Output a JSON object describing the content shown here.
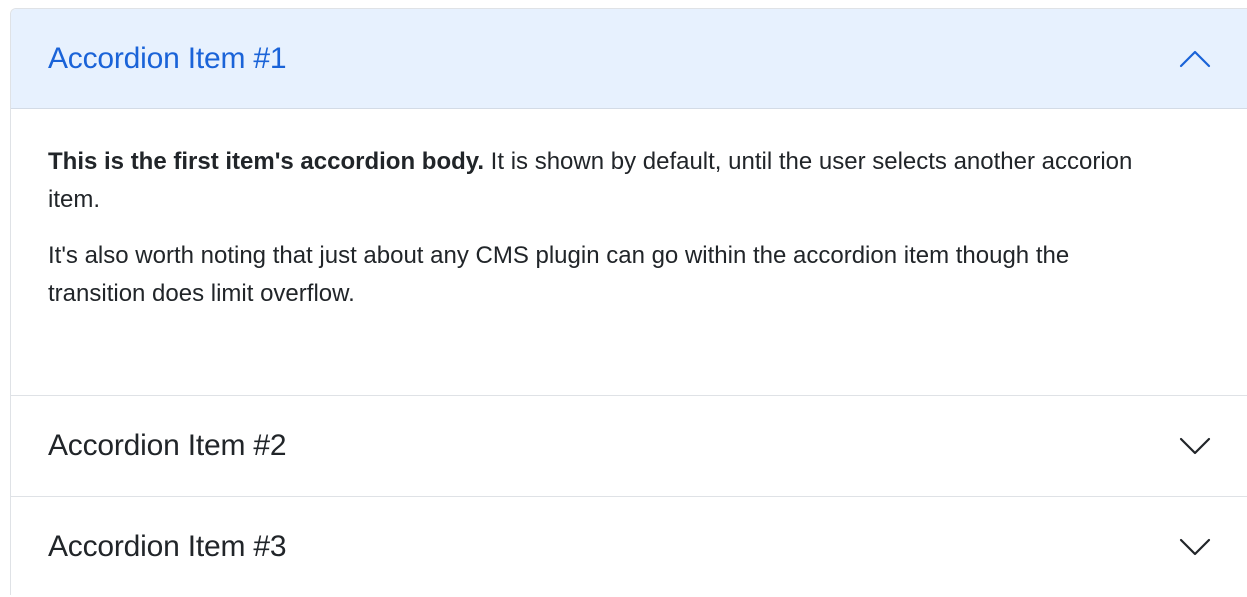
{
  "accordion": {
    "items": [
      {
        "title": "Accordion Item #1",
        "expanded": true,
        "toggle_icon": "chevron-up-icon",
        "body": {
          "p1_bold": "This is the first item's accordion body.",
          "p1_rest": " It is shown by default, until the user selects another accorion item.",
          "p2": "It's also worth noting that just about any CMS plugin can go within the accordion item though the transition does limit overflow."
        }
      },
      {
        "title": "Accordion Item #2",
        "expanded": false,
        "toggle_icon": "chevron-down-icon"
      },
      {
        "title": "Accordion Item #3",
        "expanded": false,
        "toggle_icon": "chevron-down-icon"
      }
    ]
  },
  "colors": {
    "active_header_bg": "#e7f1fe",
    "active_text": "#1a63d8",
    "text": "#212529",
    "border": "#dfe2e6"
  }
}
